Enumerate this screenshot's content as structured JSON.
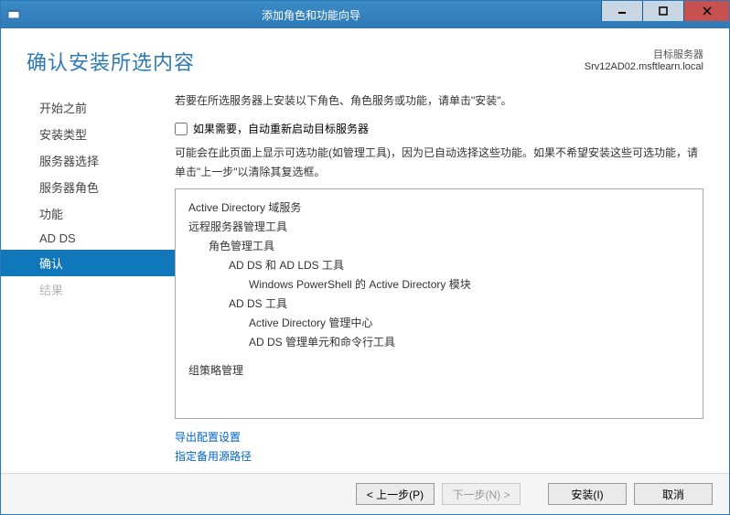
{
  "window": {
    "title": "添加角色和功能向导"
  },
  "header": {
    "heading": "确认安装所选内容",
    "target_label": "目标服务器",
    "target_server": "Srv12AD02.msftlearn.local"
  },
  "sidebar": {
    "items": [
      {
        "label": "开始之前",
        "state": "normal"
      },
      {
        "label": "安装类型",
        "state": "normal"
      },
      {
        "label": "服务器选择",
        "state": "normal"
      },
      {
        "label": "服务器角色",
        "state": "normal"
      },
      {
        "label": "功能",
        "state": "normal"
      },
      {
        "label": "AD DS",
        "state": "normal"
      },
      {
        "label": "确认",
        "state": "active"
      },
      {
        "label": "结果",
        "state": "disabled"
      }
    ]
  },
  "main": {
    "intro": "若要在所选服务器上安装以下角色、角色服务或功能，请单击\"安装\"。",
    "restart_checkbox_label": "如果需要，自动重新启动目标服务器",
    "restart_checked": false,
    "note": "可能会在此页面上显示可选功能(如管理工具)，因为已自动选择这些功能。如果不希望安装这些可选功能，请单击\"上一步\"以清除其复选框。",
    "items": [
      {
        "level": 0,
        "label": "Active Directory 域服务"
      },
      {
        "level": 0,
        "label": "远程服务器管理工具"
      },
      {
        "level": 1,
        "label": "角色管理工具"
      },
      {
        "level": 2,
        "label": "AD DS 和 AD LDS 工具"
      },
      {
        "level": 3,
        "label": "Windows PowerShell 的 Active Directory 模块"
      },
      {
        "level": 2,
        "label": "AD DS 工具"
      },
      {
        "level": 3,
        "label": "Active Directory 管理中心"
      },
      {
        "level": 3,
        "label": "AD DS 管理单元和命令行工具"
      },
      {
        "level": 0,
        "label": "组策略管理"
      }
    ],
    "links": {
      "export": "导出配置设置",
      "alt_source": "指定备用源路径"
    }
  },
  "footer": {
    "prev": "< 上一步(P)",
    "next": "下一步(N) >",
    "install": "安装(I)",
    "cancel": "取消"
  }
}
